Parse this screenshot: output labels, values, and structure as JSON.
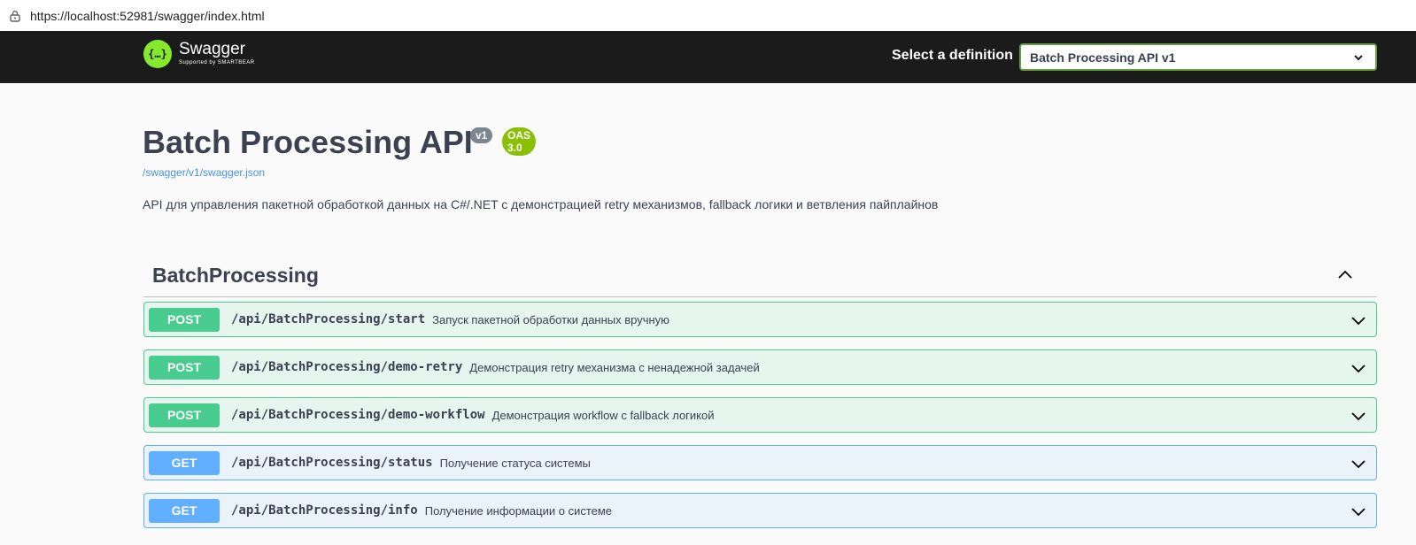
{
  "browser": {
    "url": "https://localhost:52981/swagger/index.html"
  },
  "topbar": {
    "logo_title": "Swagger",
    "logo_subtitle": "Supported by SMARTBEAR",
    "definition_label": "Select a definition",
    "definition_value": "Batch Processing API v1"
  },
  "info": {
    "title": "Batch Processing API",
    "version_badge": "v1",
    "oas_badge": "OAS 3.0",
    "spec_link": "/swagger/v1/swagger.json",
    "description": "API для управления пакетной обработкой данных на C#/.NET с демонстрацией retry механизмов, fallback логики и ветвления пайплайнов"
  },
  "tag": {
    "name": "BatchProcessing"
  },
  "operations": [
    {
      "method": "POST",
      "path": "/api/BatchProcessing/start",
      "summary": "Запуск пакетной обработки данных вручную"
    },
    {
      "method": "POST",
      "path": "/api/BatchProcessing/demo-retry",
      "summary": "Демонстрация retry механизма с ненадежной задачей"
    },
    {
      "method": "POST",
      "path": "/api/BatchProcessing/demo-workflow",
      "summary": "Демонстрация workflow с fallback логикой"
    },
    {
      "method": "GET",
      "path": "/api/BatchProcessing/status",
      "summary": "Получение статуса системы"
    },
    {
      "method": "GET",
      "path": "/api/BatchProcessing/info",
      "summary": "Получение информации о системе"
    }
  ],
  "colors": {
    "post": "#49cc90",
    "get": "#61affe",
    "topbar": "#1b1b1b",
    "accent": "#85ea2d"
  }
}
